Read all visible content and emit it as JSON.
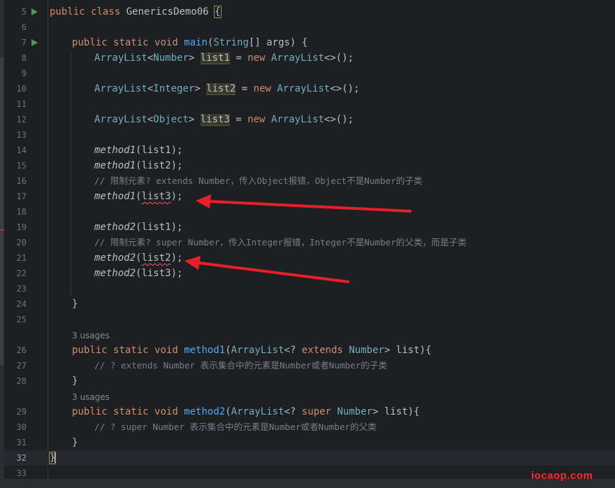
{
  "editor": {
    "lines": [
      {
        "n": "5"
      },
      {
        "n": "6"
      },
      {
        "n": "7"
      },
      {
        "n": "8"
      },
      {
        "n": "9"
      },
      {
        "n": "10"
      },
      {
        "n": "11"
      },
      {
        "n": "12"
      },
      {
        "n": "13"
      },
      {
        "n": "14"
      },
      {
        "n": "15"
      },
      {
        "n": "16"
      },
      {
        "n": "17"
      },
      {
        "n": "18"
      },
      {
        "n": "19"
      },
      {
        "n": "20"
      },
      {
        "n": "21"
      },
      {
        "n": "22"
      },
      {
        "n": "23"
      },
      {
        "n": "24"
      },
      {
        "n": "25"
      },
      {
        "n": "26"
      },
      {
        "n": "27"
      },
      {
        "n": "28"
      },
      {
        "n": "29"
      },
      {
        "n": "30"
      },
      {
        "n": "31"
      },
      {
        "n": "32"
      },
      {
        "n": "33"
      }
    ],
    "code": {
      "l5_kw1": "public",
      "l5_kw2": "class",
      "l5_name": "GenericsDemo06",
      "l5_brace": "{",
      "l7_kw1": "public",
      "l7_kw2": "static",
      "l7_kw3": "void",
      "l7_fn": "main",
      "l7_p1": "(",
      "l7_t": "String",
      "l7_p2": "[] args) ",
      "l7_brace": "{",
      "l8_t": "ArrayList",
      "l8_g1": "<",
      "l8_gt": "Number",
      "l8_g2": ">",
      "l8_var": "list1",
      "l8_eq": " = ",
      "l8_new": "new",
      "l8_t2": "ArrayList",
      "l8_rest": "<>();",
      "l10_t": "ArrayList",
      "l10_g1": "<",
      "l10_gt": "Integer",
      "l10_g2": ">",
      "l10_var": "list2",
      "l10_eq": " = ",
      "l10_new": "new",
      "l10_t2": "ArrayList",
      "l10_rest": "<>();",
      "l12_t": "ArrayList",
      "l12_g1": "<",
      "l12_gt": "Object",
      "l12_g2": ">",
      "l12_var": "list3",
      "l12_eq": " = ",
      "l12_new": "new",
      "l12_t2": "ArrayList",
      "l12_rest": "<>();",
      "l14_fn": "method1",
      "l14_args": "(list1);",
      "l15_fn": "method1",
      "l15_args": "(list2);",
      "l16_cm": "// 限制元素? extends Number，传入Object报错，Object不是Number的子类",
      "l17_fn": "method1",
      "l17_p": "(",
      "l17_arg": "list3",
      "l17_end": ");",
      "l19_fn": "method2",
      "l19_args": "(list1);",
      "l20_cm": "// 限制元素? super Number，传入Integer报错，Integer不是Number的父类，而是子类",
      "l21_fn": "method2",
      "l21_p": "(",
      "l21_arg": "list2",
      "l21_end": ");",
      "l22_fn": "method2",
      "l22_args": "(list3);",
      "l24_brace": "}",
      "usages1": "3 usages",
      "l26_kw1": "public",
      "l26_kw2": "static",
      "l26_kw3": "void",
      "l26_fn": "method1",
      "l26_p1": "(",
      "l26_t": "ArrayList",
      "l26_g1": "<? ",
      "l26_kw4": "extends",
      "l26_gt": "Number",
      "l26_g2": "> list)",
      "l26_brace": "{",
      "l27_cm": "// ? extends Number 表示集合中的元素是Number或者Number的子类",
      "l28_brace": "}",
      "usages2": "3 usages",
      "l29_kw1": "public",
      "l29_kw2": "static",
      "l29_kw3": "void",
      "l29_fn": "method2",
      "l29_p1": "(",
      "l29_t": "ArrayList",
      "l29_g1": "<? ",
      "l29_kw4": "super",
      "l29_gt": "Number",
      "l29_g2": "> list)",
      "l29_brace": "{",
      "l30_cm": "// ? super Number 表示集合中的元素是Number或者Number的父类",
      "l31_brace": "}",
      "l32_brace": "}"
    }
  },
  "icons": {
    "run": "run-gutter-icon"
  },
  "colors": {
    "keyword": "#cf8e6d",
    "function": "#56a8f5",
    "comment": "#7a7e85",
    "type": "#2aacb8",
    "arrow": "#e8202a",
    "error": "#ff5261",
    "watermark": "#ff2a2a"
  },
  "watermark": "iocaop.com"
}
